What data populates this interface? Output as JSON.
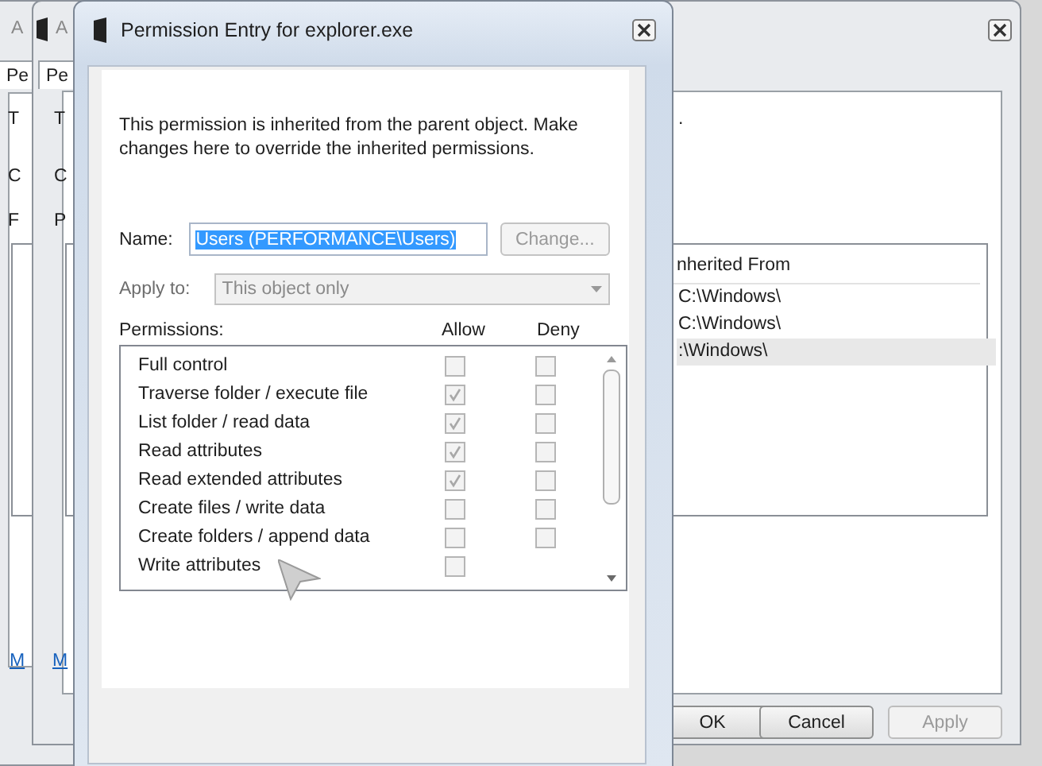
{
  "back_window": {
    "title": "A",
    "tab": "Pe",
    "labels": [
      "T",
      "C",
      "F"
    ],
    "link": "M"
  },
  "middle_window": {
    "title": "A",
    "tab": "Pe",
    "labels": [
      "T",
      "C",
      "P"
    ],
    "fragment": ".",
    "list": {
      "header": "nherited From",
      "rows": [
        {
          "text": "C:\\Windows\\",
          "selected": false
        },
        {
          "text": "C:\\Windows\\",
          "selected": false
        },
        {
          "text": ":\\Windows\\",
          "selected": true
        }
      ]
    },
    "link": "M",
    "buttons": [
      {
        "label": "OK",
        "disabled": false
      },
      {
        "label": "Cancel",
        "disabled": false
      },
      {
        "label": "Apply",
        "disabled": true
      }
    ]
  },
  "dialog": {
    "title": "Permission Entry for explorer.exe",
    "message": "This permission is inherited from the parent object. Make changes here to override the inherited permissions.",
    "name_label": "Name:",
    "name_value": "Users (PERFORMANCE\\Users)",
    "change_button": {
      "label": "Change...",
      "disabled": true
    },
    "apply_to_label": "Apply to:",
    "apply_to": {
      "value": "This object only",
      "disabled": true
    },
    "permissions_label": "Permissions:",
    "allow_label": "Allow",
    "deny_label": "Deny",
    "permissions_disabled": true,
    "permissions": [
      {
        "name": "Full control",
        "allow": false,
        "deny": false
      },
      {
        "name": "Traverse folder / execute file",
        "allow": true,
        "deny": false
      },
      {
        "name": "List folder / read data",
        "allow": true,
        "deny": false
      },
      {
        "name": "Read attributes",
        "allow": true,
        "deny": false
      },
      {
        "name": "Read extended attributes",
        "allow": true,
        "deny": false
      },
      {
        "name": "Create files / write data",
        "allow": false,
        "deny": false
      },
      {
        "name": "Create folders / append data",
        "allow": false,
        "deny": false
      },
      {
        "name": "Write attributes",
        "allow": false
      }
    ]
  }
}
